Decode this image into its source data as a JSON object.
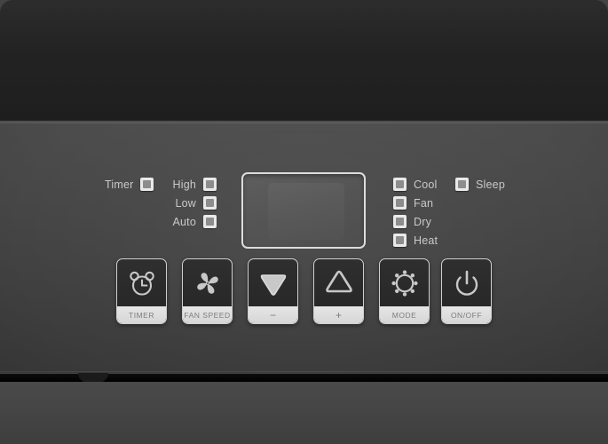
{
  "device": {
    "type": "air-conditioner-control-panel",
    "display_value": ""
  },
  "indicators": {
    "timer": {
      "label": "Timer",
      "lit": false,
      "icon": "indicator-lamp"
    },
    "fan_speed": [
      {
        "label": "High",
        "lit": false
      },
      {
        "label": "Low",
        "lit": false
      },
      {
        "label": "Auto",
        "lit": false
      }
    ],
    "modes": [
      {
        "label": "Cool",
        "lit": false
      },
      {
        "label": "Fan",
        "lit": false
      },
      {
        "label": "Dry",
        "lit": false
      },
      {
        "label": "Heat",
        "lit": false
      }
    ],
    "sleep": {
      "label": "Sleep",
      "lit": false
    }
  },
  "buttons": [
    {
      "label": "TIMER",
      "icon": "alarm-clock-icon"
    },
    {
      "label": "FAN SPEED",
      "icon": "fan-blade-icon"
    },
    {
      "label": "−",
      "icon": "triangle-down-icon"
    },
    {
      "label": "+",
      "icon": "triangle-up-icon"
    },
    {
      "label": "MODE",
      "icon": "sun-mode-icon"
    },
    {
      "label": "ON/OFF",
      "icon": "power-icon"
    }
  ],
  "colors": {
    "grille": "#222222",
    "panel": "#464646",
    "lamp_face": "#e9e9e9",
    "lamp_core": "#8d8d8d",
    "label_text": "#c9c9c9",
    "button_body": "#282828",
    "button_border": "#cfcfcf",
    "button_label_bg": "#dedede",
    "button_label_text": "#7d7d7d",
    "icon": "#c8c8c8"
  }
}
